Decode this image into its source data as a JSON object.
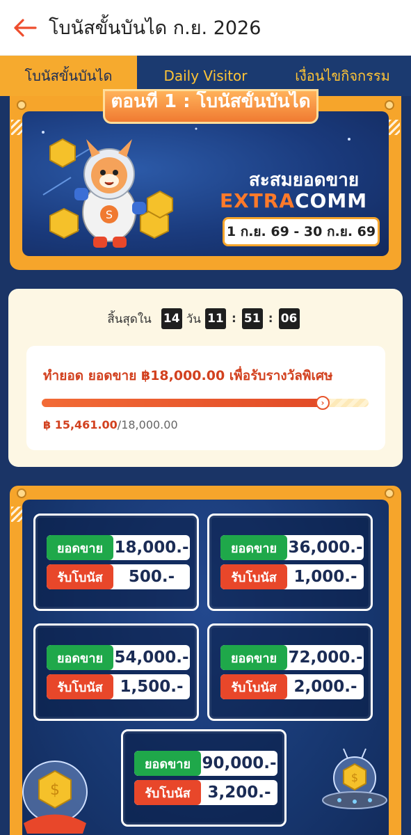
{
  "header": {
    "title": "โบนัสขั้นบันได ก.ย. 2026"
  },
  "tabs": [
    {
      "label": "โบนัสขั้นบันได",
      "active": true
    },
    {
      "label": "Daily Visitor",
      "active": false
    },
    {
      "label": "เงื่อนไขกิจกรรม",
      "active": false
    }
  ],
  "hero": {
    "ribbon": "ตอนที่ 1 : โบนัสขั้นบันได",
    "title": "สะสมยอดขาย",
    "brand_part1": "EXTRA",
    "brand_part2": "COMM",
    "dates": "1 ก.ย. 69 - 30 ก.ย. 69"
  },
  "countdown": {
    "label": "สิ้นสุดใน",
    "days": "14",
    "days_unit": "วัน",
    "hours": "11",
    "minutes": "51",
    "seconds": "06"
  },
  "goal": {
    "text": "ทำยอด ยอดขาย ฿18,000.00 เพื่อรับรางวัลพิเศษ",
    "current": "฿ 15,461.00",
    "target": "/18,000.00",
    "progress": 0.859
  },
  "tiers": [
    {
      "sales_label": "ยอดขาย",
      "sales": "18,000.-",
      "bonus_label": "รับโบนัส",
      "bonus": "500.-"
    },
    {
      "sales_label": "ยอดขาย",
      "sales": "36,000.-",
      "bonus_label": "รับโบนัส",
      "bonus": "1,000.-"
    },
    {
      "sales_label": "ยอดขาย",
      "sales": "54,000.-",
      "bonus_label": "รับโบนัส",
      "bonus": "1,500.-"
    },
    {
      "sales_label": "ยอดขาย",
      "sales": "72,000.-",
      "bonus_label": "รับโบนัส",
      "bonus": "2,000.-"
    },
    {
      "sales_label": "ยอดขาย",
      "sales": "90,000.-",
      "bonus_label": "รับโบนัส",
      "bonus": "3,200.-"
    }
  ],
  "colors": {
    "accent_orange": "#f6a52b",
    "navy": "#1b3a70",
    "sales_green": "#1fa84a",
    "bonus_red": "#e8472a",
    "progress_red": "#e24b27"
  }
}
